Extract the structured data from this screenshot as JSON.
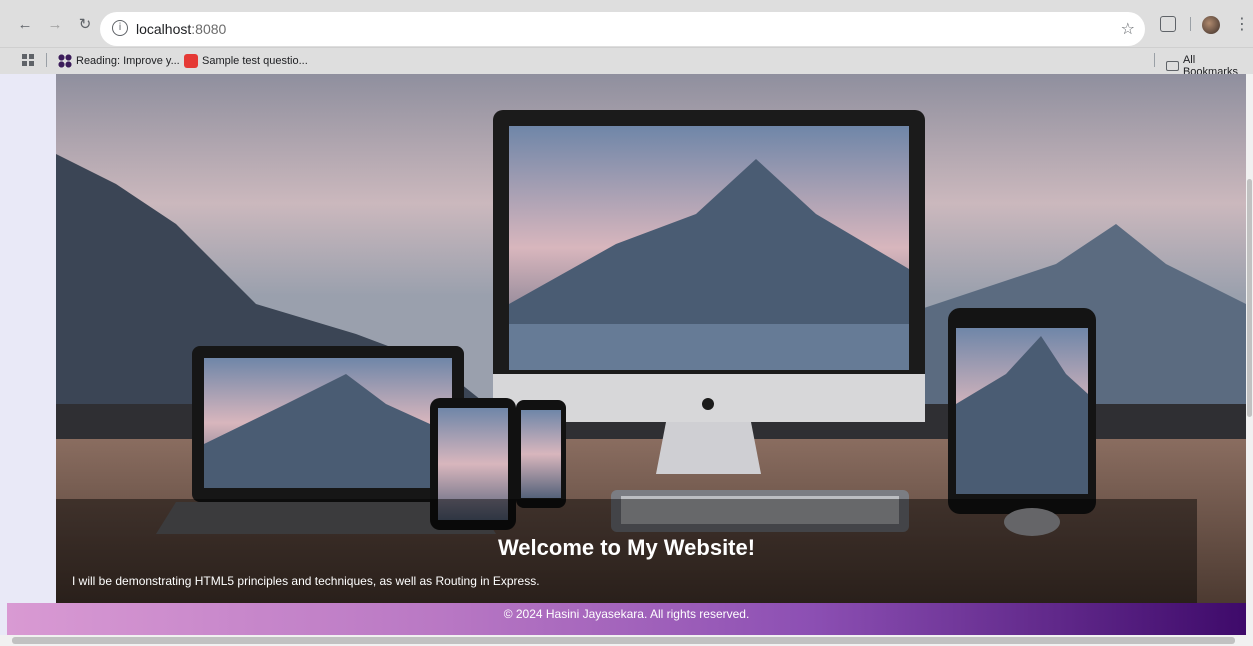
{
  "browser": {
    "url_host": "localhost",
    "url_port": ":8080",
    "bookmarks": [
      {
        "label": "Reading: Improve y..."
      },
      {
        "label": "Sample test questio..."
      }
    ],
    "all_bookmarks_label": "All Bookmarks"
  },
  "hero": {
    "title": "Welcome to My Website!",
    "subtitle": "I will be demonstrating HTML5 principles and techniques, as well as Routing in Express."
  },
  "footer": {
    "text": "© 2024 Hasini Jayasekara. All rights reserved."
  },
  "colors": {
    "footer_gradient_start": "#d99ad3",
    "footer_gradient_end": "#3e0a6a",
    "caption_overlay": "rgba(0,0,0,0.45)"
  }
}
